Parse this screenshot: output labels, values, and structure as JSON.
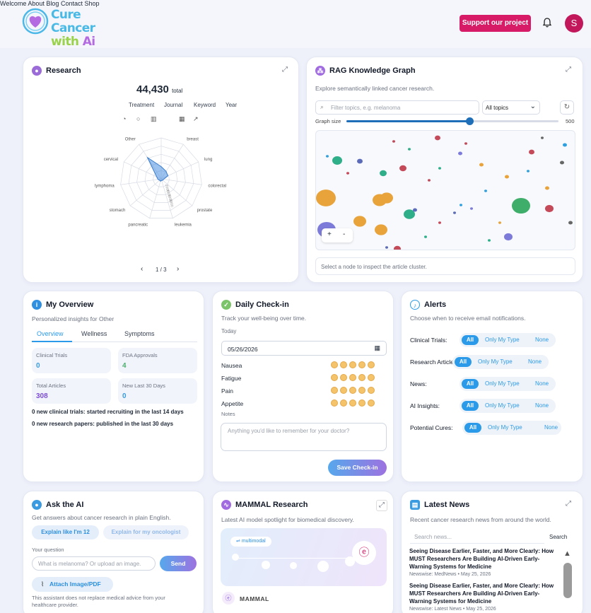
{
  "brand": {
    "line1": "Cure Cancer",
    "line2a": "with ",
    "line2b": "Ai"
  },
  "nav": [
    "Welcome",
    "About",
    "Blog",
    "Contact",
    "Shop"
  ],
  "support_label": "Support our project",
  "user_initial": "S",
  "research": {
    "title": "Research",
    "total": "44,430",
    "total_suffix": "total",
    "filters": [
      "Treatment",
      "Journal",
      "Keyword",
      "Year"
    ],
    "pager": "1 / 3",
    "radar_labels": [
      "Unknown",
      "breast",
      "lung",
      "colorectal",
      "prostate",
      "leukemia",
      "pancreatic",
      "stomach",
      "lymphoma",
      "cervical",
      "Other"
    ],
    "radar_ticks": [
      "2000",
      "4000",
      "6000",
      "8000"
    ]
  },
  "rag": {
    "title": "RAG Knowledge Graph",
    "subtitle": "Explore semantically linked cancer research.",
    "search_placeholder": "Filter topics, e.g. melanoma",
    "topic": "All topics",
    "graph_size_label": "Graph size",
    "graph_size_max": "500",
    "graph_size_value": 0.58,
    "zoom_in": "+",
    "zoom_out": "-",
    "inspect": "Select a node to inspect the article cluster."
  },
  "overview": {
    "title": "My Overview",
    "subtitle": "Personalized insights for Other",
    "tabs": [
      "Overview",
      "Wellness",
      "Symptoms"
    ],
    "stats": [
      {
        "label": "Clinical Trials",
        "value": "0",
        "color": "#3b9be0"
      },
      {
        "label": "FDA Approvals",
        "value": "4",
        "color": "#4cae6e"
      },
      {
        "label": "Total Articles",
        "value": "308",
        "color": "#7c4dd4"
      },
      {
        "label": "New Last 30 Days",
        "value": "0",
        "color": "#3b9be0"
      }
    ],
    "note1": "0 new clinical trials: started recruiting in the last 14 days",
    "note2": "0 new research papers: published in the last 30 days"
  },
  "checkin": {
    "title": "Daily Check-in",
    "subtitle": "Track your well-being over time.",
    "today_label": "Today",
    "date": "05/26/2026",
    "symptoms": [
      "Nausea",
      "Fatigue",
      "Pain",
      "Appetite"
    ],
    "notes_label": "Notes",
    "notes_placeholder": "Anything you'd like to remember for your doctor?",
    "save": "Save Check-in"
  },
  "alerts": {
    "title": "Alerts",
    "subtitle": "Choose when to receive email notifications.",
    "rows": [
      {
        "label": "Clinical Trials:"
      },
      {
        "label": "Research Articles:"
      },
      {
        "label": "News:"
      },
      {
        "label": "AI Insights:"
      },
      {
        "label": "Potential Cures:"
      }
    ],
    "opt_all": "All",
    "opt_mine": "Only My Type",
    "opt_none": "None"
  },
  "ask": {
    "title": "Ask the AI",
    "subtitle": "Get answers about cancer research in plain English.",
    "btn_simple": "Explain like I'm 12",
    "btn_onc": "Explain for my oncologist",
    "question_label": "Your question",
    "placeholder": "What is melanoma? Or upload an image.",
    "send": "Send",
    "attach": "Attach Image/PDF",
    "disclaimer": "This assistant does not replace medical advice from your healthcare provider."
  },
  "mammal": {
    "title": "MAMMAL Research",
    "subtitle": "Latest AI model spotlight for biomedical discovery.",
    "tag": "multimodal",
    "name": "MAMMAL"
  },
  "news": {
    "title": "Latest News",
    "subtitle": "Recent cancer research news from around the world.",
    "search_placeholder": "Search news...",
    "search_btn": "Search",
    "items": [
      {
        "headline": "Seeing Disease Earlier, Faster, and More Clearly: How MUST Researchers Are Building AI-Driven Early-Warning Systems for Medicine",
        "meta": "Newswise: MedNews • May 25, 2026"
      },
      {
        "headline": "Seeing Disease Earlier, Faster, and More Clearly: How MUST Researchers Are Building AI-Driven Early-Warning Systems for Medicine",
        "meta": "Newswise: Latest News • May 25, 2026"
      }
    ]
  }
}
